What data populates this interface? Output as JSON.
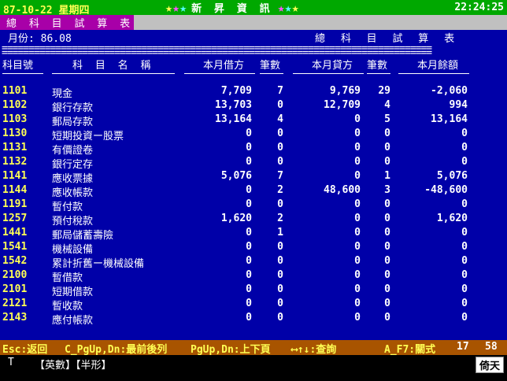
{
  "topbar": {
    "date": "87-10-22 星期四",
    "brand": "新 昇 資 訊",
    "time": "22:24:25",
    "star_colors": [
      "#ffff54",
      "#ff54ff",
      "#54ffff"
    ]
  },
  "titlebar": {
    "label": "總 科 目 試 算 表"
  },
  "header": {
    "month": "月份: 86.08",
    "report_title": "總 科 目 試 算 表"
  },
  "columns": {
    "code": "科目號",
    "name": "科 目 名 稱",
    "debit": "本月借方",
    "debit_count": "筆數",
    "credit": "本月貸方",
    "credit_count": "筆數",
    "balance": "本月餘額"
  },
  "rows": [
    {
      "code": "1101",
      "name": "現金",
      "debit": "7,709",
      "dc": "7",
      "credit": "9,769",
      "cc": "29",
      "bal": "-2,060"
    },
    {
      "code": "1102",
      "name": "銀行存款",
      "debit": "13,703",
      "dc": "0",
      "credit": "12,709",
      "cc": "4",
      "bal": "994"
    },
    {
      "code": "1103",
      "name": "郵局存款",
      "debit": "13,164",
      "dc": "4",
      "credit": "0",
      "cc": "5",
      "bal": "13,164"
    },
    {
      "code": "1130",
      "name": "短期投資ー股票",
      "debit": "0",
      "dc": "0",
      "credit": "0",
      "cc": "0",
      "bal": "0"
    },
    {
      "code": "1131",
      "name": "有價證卷",
      "debit": "0",
      "dc": "0",
      "credit": "0",
      "cc": "0",
      "bal": "0"
    },
    {
      "code": "1132",
      "name": "銀行定存",
      "debit": "0",
      "dc": "0",
      "credit": "0",
      "cc": "0",
      "bal": "0"
    },
    {
      "code": "1141",
      "name": "應收票據",
      "debit": "5,076",
      "dc": "7",
      "credit": "0",
      "cc": "1",
      "bal": "5,076"
    },
    {
      "code": "1144",
      "name": "應收帳款",
      "debit": "0",
      "dc": "2",
      "credit": "48,600",
      "cc": "3",
      "bal": "-48,600"
    },
    {
      "code": "1191",
      "name": "暫付款",
      "debit": "0",
      "dc": "0",
      "credit": "0",
      "cc": "0",
      "bal": "0"
    },
    {
      "code": "1257",
      "name": "預付稅款",
      "debit": "1,620",
      "dc": "2",
      "credit": "0",
      "cc": "0",
      "bal": "1,620"
    },
    {
      "code": "1441",
      "name": "郵局儲蓄壽險",
      "debit": "0",
      "dc": "1",
      "credit": "0",
      "cc": "0",
      "bal": "0"
    },
    {
      "code": "1541",
      "name": "機械設備",
      "debit": "0",
      "dc": "0",
      "credit": "0",
      "cc": "0",
      "bal": "0"
    },
    {
      "code": "1542",
      "name": "累計折舊ー機械設備",
      "debit": "0",
      "dc": "0",
      "credit": "0",
      "cc": "0",
      "bal": "0"
    },
    {
      "code": "2100",
      "name": "暫借款",
      "debit": "0",
      "dc": "0",
      "credit": "0",
      "cc": "0",
      "bal": "0"
    },
    {
      "code": "2101",
      "name": "短期借款",
      "debit": "0",
      "dc": "0",
      "credit": "0",
      "cc": "0",
      "bal": "0"
    },
    {
      "code": "2121",
      "name": "暫收款",
      "debit": "0",
      "dc": "0",
      "credit": "0",
      "cc": "0",
      "bal": "0"
    },
    {
      "code": "2143",
      "name": "應付帳款",
      "debit": "0",
      "dc": "0",
      "credit": "0",
      "cc": "0",
      "bal": "0"
    }
  ],
  "status": {
    "esc": "Esc:返回",
    "c_pg": "C_PgUp,Dn:最前後列",
    "pg": "PgUp,Dn:上下頁",
    "arrows": "⟷↑↓:查詢",
    "af7": "A_F7:關式",
    "page": "17",
    "total": "58"
  },
  "bottom": {
    "ime": "T",
    "mode": "【英數】【半形】",
    "brand": "倚天"
  }
}
